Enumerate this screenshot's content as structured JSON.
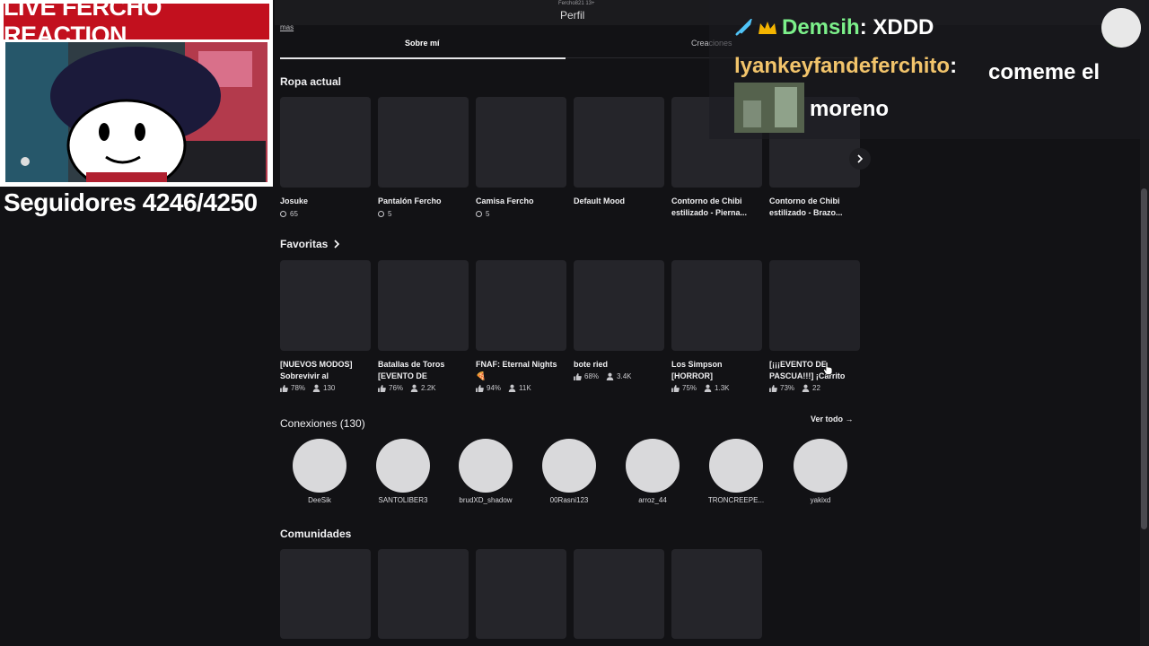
{
  "header": {
    "subtitle": "Fercho821 13+",
    "title": "Perfil",
    "back_link": "mas"
  },
  "tabs": [
    {
      "label": "Sobre mí",
      "active": true
    },
    {
      "label": "Creaciones",
      "active": false
    }
  ],
  "ropa": {
    "title": "Ropa actual",
    "items": [
      {
        "name": "Josuke",
        "price": "65"
      },
      {
        "name": "Pantalón Fercho",
        "price": "5"
      },
      {
        "name": "Camisa Fercho",
        "price": "5"
      },
      {
        "name": "Default Mood",
        "price": ""
      },
      {
        "name": "Contorno de Chibi estilizado - Pierna...",
        "price": ""
      },
      {
        "name": "Contorno de Chibi estilizado - Brazo...",
        "price": ""
      }
    ]
  },
  "favoritas": {
    "title": "Favoritas",
    "items": [
      {
        "name": "[NUEVOS MODOS] Sobrevivir al",
        "rating": "78%",
        "players": "130"
      },
      {
        "name": "Batallas de Toros [EVENTO DE",
        "rating": "76%",
        "players": "2.2K"
      },
      {
        "name": "FNAF: Eternal Nights 🍕",
        "rating": "94%",
        "players": "11K"
      },
      {
        "name": "bote ried",
        "rating": "68%",
        "players": "3.4K"
      },
      {
        "name": "Los Simpson [HORROR]",
        "rating": "75%",
        "players": "1.3K"
      },
      {
        "name": "[¡¡¡EVENTO DE PASCUA!!!] ¡Carrito",
        "rating": "73%",
        "players": "22"
      }
    ]
  },
  "conexiones": {
    "title": "Conexiones (130)",
    "see_all": "Ver todo →",
    "items": [
      "DeeSik",
      "SANTOLIBER3",
      "brudXD_shadow",
      "00Rasni123",
      "arroz_44",
      "TRONCREEPE...",
      "yakixd"
    ]
  },
  "comunidades": {
    "title": "Comunidades"
  },
  "overlay": {
    "stream_title": "LIVE FERCHO REACTION",
    "followers": "Seguidores 4246/4250"
  },
  "chat": [
    {
      "user": "Demsih",
      "message": "XDDD",
      "user_color": "#7cf08a"
    },
    {
      "user": "lyankeyfandeferchito",
      "message": "comeme el moreno",
      "user_color": "#f2c46b"
    }
  ],
  "colors": {
    "background": "#121215",
    "stream_red": "#c2101e"
  }
}
